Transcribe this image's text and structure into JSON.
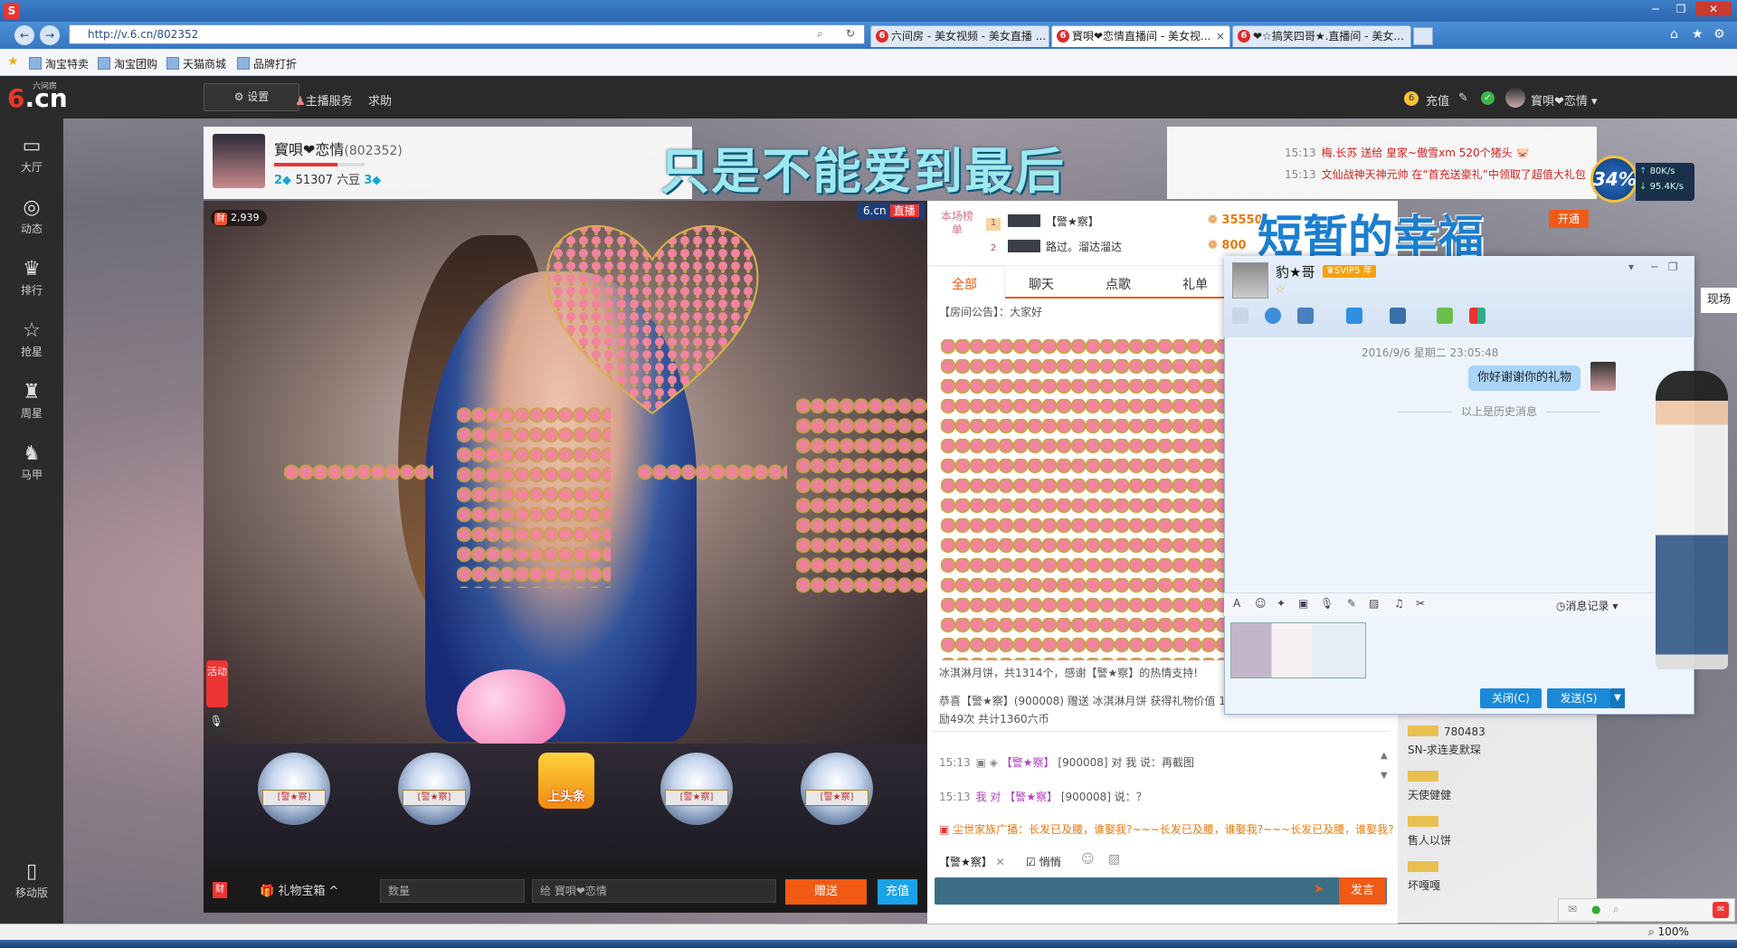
{
  "browser": {
    "address": "http://v.6.cn/802352",
    "tabs": [
      {
        "label": "六间房 - 美女视频 - 美女直播 ..."
      },
      {
        "label": "寳唄❤恋情直播间 - 美女视..."
      },
      {
        "label": "❤☆搞笑四哥★.直播间 - 美女..."
      }
    ],
    "bookmarks": [
      "淘宝特卖",
      "淘宝团购",
      "天猫商城",
      "品牌打折"
    ],
    "zoom": "100%"
  },
  "site": {
    "logo": "6.cn",
    "logo_sub": "六间房",
    "settings_label": "设置",
    "nav": [
      "主播服务",
      "求助"
    ],
    "recharge_label": "充值",
    "user_name": "寳唄❤恋情"
  },
  "leftnav": {
    "items": [
      {
        "label": "大厅",
        "icon": "tv-icon",
        "glyph": "▭"
      },
      {
        "label": "动态",
        "icon": "compass-icon",
        "glyph": "◎"
      },
      {
        "label": "排行",
        "icon": "crown-icon",
        "glyph": "♛"
      },
      {
        "label": "抢星",
        "icon": "star-icon",
        "glyph": "☆"
      },
      {
        "label": "周星",
        "icon": "cup-icon",
        "glyph": "♜"
      },
      {
        "label": "马甲",
        "icon": "shirt-icon",
        "glyph": "♞"
      }
    ],
    "mobile_label": "移动版"
  },
  "anchor": {
    "name": "寳唄❤恋情",
    "id": "(802352)",
    "level": "2",
    "beans": "51307 六豆",
    "diamond": "3",
    "level_progress": 0.7
  },
  "overlay": {
    "title1": "只是不能爱到最后",
    "title2": "短暂的幸福"
  },
  "feed": [
    {
      "time": "15:13",
      "text": "梅.长苏 送给 皇家~傲雪xm 520个猪头"
    },
    {
      "time": "15:13",
      "text": "文仙战神天神元帅 在“首充送豪礼”中领取了超值大礼包"
    }
  ],
  "video": {
    "viewers": "2,939",
    "brand": "6.cn",
    "live_label": "直播",
    "side_tag": "活动"
  },
  "seats": [
    {
      "label": "[警★察]"
    },
    {
      "label": "[警★察]"
    },
    {
      "label": "上头条"
    },
    {
      "label": "[警★察]"
    },
    {
      "label": "[警★察]"
    }
  ],
  "giftbar": {
    "treasure_label": "礼物宝箱",
    "quantity_placeholder": "数量",
    "recipient": "给 寳唄❤恋情",
    "send_label": "赠送",
    "recharge_label": "充值"
  },
  "ranking": {
    "label": "本场榜单",
    "rows": [
      {
        "rank": "1",
        "name": "【警★察】",
        "coins": "35550"
      },
      {
        "rank": "2",
        "name": "路过。溜达溜达",
        "coins": "800"
      }
    ],
    "open_label": "开通"
  },
  "chat": {
    "tabs": [
      "全部",
      "聊天",
      "点歌",
      "礼单"
    ],
    "notice": "【房间公告】：大家好",
    "thanks": "冰淇淋月饼，共1314个，感谢【警★察】的热情支持!",
    "congrats1": "恭喜【警★察】(900008) 赠送 冰淇淋月饼 获得礼物价值 16",
    "congrats2": "励49次 共计1360六币",
    "messages": [
      {
        "time": "15:13",
        "name": "【警★察】",
        "text": "[900008] 对 我 说：再截图"
      },
      {
        "time": "15:13",
        "name": "我 对 【警★察】",
        "text": "[900008] 说：？"
      }
    ],
    "broadcast": "尘世家族广播：长发已及腰，谁娶我?~~~长发已及腰，谁娶我?~~~长发已及腰，谁娶我?",
    "target": "【警★察】",
    "whisper_label": "悄悄",
    "speak_label": "发言"
  },
  "userlist": [
    {
      "name": "780483"
    },
    {
      "name": "SN-求连麦默琛"
    },
    {
      "name": "天使健健"
    },
    {
      "name": "售人以饼"
    },
    {
      "name": "坏嘎嘎"
    }
  ],
  "speed": {
    "percent": "34%",
    "up": "80K/s",
    "down": "95.4K/s"
  },
  "qq": {
    "name": "豹★哥",
    "vip": "SVIP5",
    "year": "年",
    "date": "2016/9/6 星期二 23:05:48",
    "message": "你好谢谢你的礼物",
    "history": "以上是历史消息",
    "record_label": "消息记录",
    "close_label": "关闭(C)",
    "send_label": "发送(S)"
  },
  "side": {
    "xianchang": "现场"
  }
}
